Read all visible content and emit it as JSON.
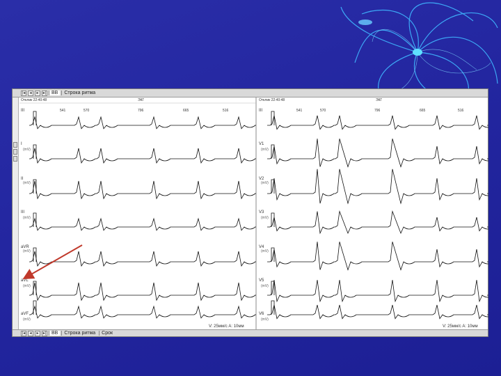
{
  "window": {
    "tabs": [
      "ВВ",
      "Строка ритма"
    ],
    "bottom_tabs": [
      "ВВ",
      "Строка ритма",
      "Срок"
    ]
  },
  "panels": [
    {
      "time": "Отклик 22:40:48",
      "beat_label": "ЭКГ",
      "intervals": [
        "541",
        "570",
        "796",
        "665",
        "516"
      ],
      "leads": [
        "III",
        "I",
        "II",
        "III",
        "aVR",
        "aVL",
        "aVF"
      ],
      "unit": "(mV)",
      "scale": "V: 25мм/с A: 10мм"
    },
    {
      "time": "Отклик 22:40:48",
      "beat_label": "ЭКГ",
      "intervals": [
        "541",
        "570",
        "796",
        "665",
        "516"
      ],
      "leads": [
        "III",
        "V1",
        "V2",
        "V3",
        "V4",
        "V5",
        "V6"
      ],
      "unit": "(mV)",
      "scale": "V: 25мм/с A: 10мм"
    }
  ],
  "colors": {
    "background": "#2326a0",
    "annotation_arrow": "#c0392b",
    "trace": "#111111"
  }
}
